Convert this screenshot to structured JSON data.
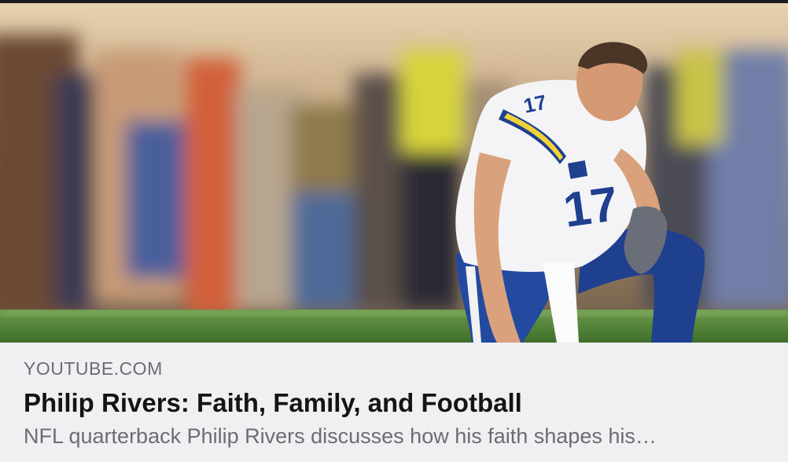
{
  "link_preview": {
    "domain": "YOUTUBE.COM",
    "title": "Philip Rivers: Faith, Family, and Football",
    "description": "NFL quarterback Philip Rivers discusses how his faith shapes his…",
    "thumbnail": {
      "subject": "kneeling football player in white jersey number 17",
      "jersey_number": "17",
      "colors": {
        "jersey": "#f4f4f6",
        "pants": "#1f3f8f",
        "field": "#4c7c34",
        "crowd_warm": "#c98e58",
        "crowd_cool": "#5a6c9a",
        "vest": "#d7d43a"
      }
    }
  }
}
